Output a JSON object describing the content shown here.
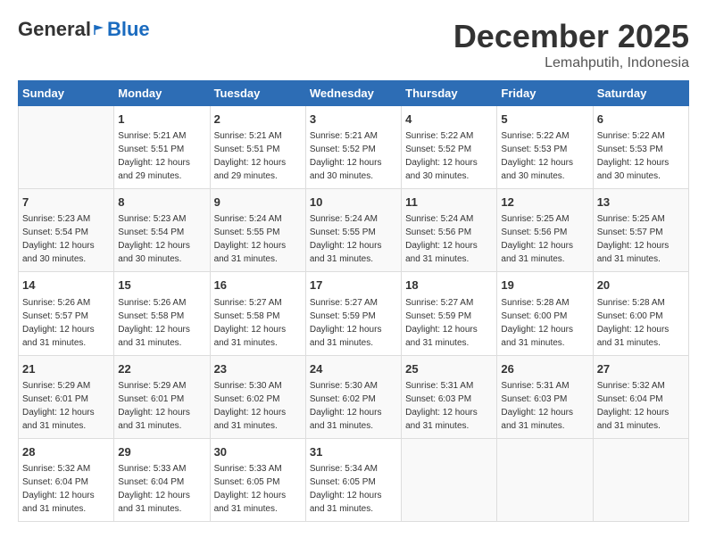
{
  "header": {
    "logo": {
      "part1": "General",
      "part2": "Blue"
    },
    "title": "December 2025",
    "location": "Lemahputih, Indonesia"
  },
  "weekdays": [
    "Sunday",
    "Monday",
    "Tuesday",
    "Wednesday",
    "Thursday",
    "Friday",
    "Saturday"
  ],
  "weeks": [
    [
      {
        "day": "",
        "info": ""
      },
      {
        "day": "1",
        "info": "Sunrise: 5:21 AM\nSunset: 5:51 PM\nDaylight: 12 hours\nand 29 minutes."
      },
      {
        "day": "2",
        "info": "Sunrise: 5:21 AM\nSunset: 5:51 PM\nDaylight: 12 hours\nand 29 minutes."
      },
      {
        "day": "3",
        "info": "Sunrise: 5:21 AM\nSunset: 5:52 PM\nDaylight: 12 hours\nand 30 minutes."
      },
      {
        "day": "4",
        "info": "Sunrise: 5:22 AM\nSunset: 5:52 PM\nDaylight: 12 hours\nand 30 minutes."
      },
      {
        "day": "5",
        "info": "Sunrise: 5:22 AM\nSunset: 5:53 PM\nDaylight: 12 hours\nand 30 minutes."
      },
      {
        "day": "6",
        "info": "Sunrise: 5:22 AM\nSunset: 5:53 PM\nDaylight: 12 hours\nand 30 minutes."
      }
    ],
    [
      {
        "day": "7",
        "info": "Sunrise: 5:23 AM\nSunset: 5:54 PM\nDaylight: 12 hours\nand 30 minutes."
      },
      {
        "day": "8",
        "info": "Sunrise: 5:23 AM\nSunset: 5:54 PM\nDaylight: 12 hours\nand 30 minutes."
      },
      {
        "day": "9",
        "info": "Sunrise: 5:24 AM\nSunset: 5:55 PM\nDaylight: 12 hours\nand 31 minutes."
      },
      {
        "day": "10",
        "info": "Sunrise: 5:24 AM\nSunset: 5:55 PM\nDaylight: 12 hours\nand 31 minutes."
      },
      {
        "day": "11",
        "info": "Sunrise: 5:24 AM\nSunset: 5:56 PM\nDaylight: 12 hours\nand 31 minutes."
      },
      {
        "day": "12",
        "info": "Sunrise: 5:25 AM\nSunset: 5:56 PM\nDaylight: 12 hours\nand 31 minutes."
      },
      {
        "day": "13",
        "info": "Sunrise: 5:25 AM\nSunset: 5:57 PM\nDaylight: 12 hours\nand 31 minutes."
      }
    ],
    [
      {
        "day": "14",
        "info": "Sunrise: 5:26 AM\nSunset: 5:57 PM\nDaylight: 12 hours\nand 31 minutes."
      },
      {
        "day": "15",
        "info": "Sunrise: 5:26 AM\nSunset: 5:58 PM\nDaylight: 12 hours\nand 31 minutes."
      },
      {
        "day": "16",
        "info": "Sunrise: 5:27 AM\nSunset: 5:58 PM\nDaylight: 12 hours\nand 31 minutes."
      },
      {
        "day": "17",
        "info": "Sunrise: 5:27 AM\nSunset: 5:59 PM\nDaylight: 12 hours\nand 31 minutes."
      },
      {
        "day": "18",
        "info": "Sunrise: 5:27 AM\nSunset: 5:59 PM\nDaylight: 12 hours\nand 31 minutes."
      },
      {
        "day": "19",
        "info": "Sunrise: 5:28 AM\nSunset: 6:00 PM\nDaylight: 12 hours\nand 31 minutes."
      },
      {
        "day": "20",
        "info": "Sunrise: 5:28 AM\nSunset: 6:00 PM\nDaylight: 12 hours\nand 31 minutes."
      }
    ],
    [
      {
        "day": "21",
        "info": "Sunrise: 5:29 AM\nSunset: 6:01 PM\nDaylight: 12 hours\nand 31 minutes."
      },
      {
        "day": "22",
        "info": "Sunrise: 5:29 AM\nSunset: 6:01 PM\nDaylight: 12 hours\nand 31 minutes."
      },
      {
        "day": "23",
        "info": "Sunrise: 5:30 AM\nSunset: 6:02 PM\nDaylight: 12 hours\nand 31 minutes."
      },
      {
        "day": "24",
        "info": "Sunrise: 5:30 AM\nSunset: 6:02 PM\nDaylight: 12 hours\nand 31 minutes."
      },
      {
        "day": "25",
        "info": "Sunrise: 5:31 AM\nSunset: 6:03 PM\nDaylight: 12 hours\nand 31 minutes."
      },
      {
        "day": "26",
        "info": "Sunrise: 5:31 AM\nSunset: 6:03 PM\nDaylight: 12 hours\nand 31 minutes."
      },
      {
        "day": "27",
        "info": "Sunrise: 5:32 AM\nSunset: 6:04 PM\nDaylight: 12 hours\nand 31 minutes."
      }
    ],
    [
      {
        "day": "28",
        "info": "Sunrise: 5:32 AM\nSunset: 6:04 PM\nDaylight: 12 hours\nand 31 minutes."
      },
      {
        "day": "29",
        "info": "Sunrise: 5:33 AM\nSunset: 6:04 PM\nDaylight: 12 hours\nand 31 minutes."
      },
      {
        "day": "30",
        "info": "Sunrise: 5:33 AM\nSunset: 6:05 PM\nDaylight: 12 hours\nand 31 minutes."
      },
      {
        "day": "31",
        "info": "Sunrise: 5:34 AM\nSunset: 6:05 PM\nDaylight: 12 hours\nand 31 minutes."
      },
      {
        "day": "",
        "info": ""
      },
      {
        "day": "",
        "info": ""
      },
      {
        "day": "",
        "info": ""
      }
    ]
  ]
}
